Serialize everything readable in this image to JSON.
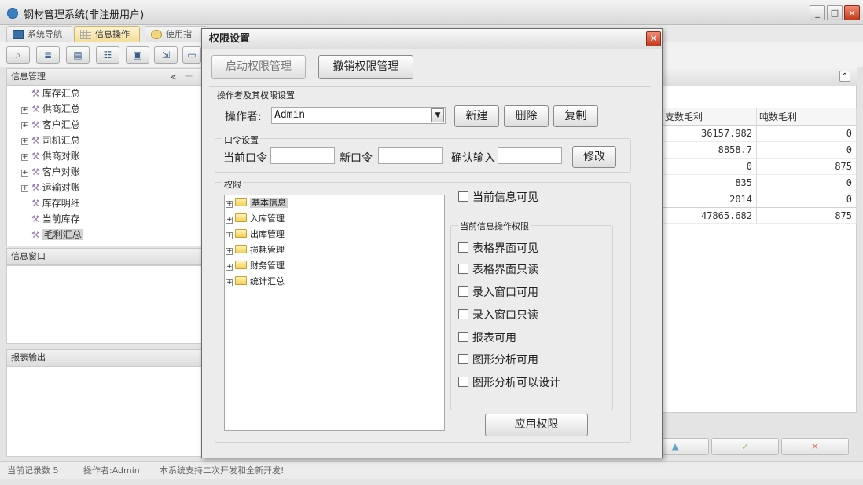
{
  "window": {
    "title": "钢材管理系统(非注册用户)",
    "min": "_",
    "max": "□",
    "close": "×"
  },
  "tabs": [
    {
      "label": "系统导航"
    },
    {
      "label": "信息操作"
    },
    {
      "label": "使用指南"
    }
  ],
  "sidebar": {
    "info_title": "信息管理",
    "collapse": "«",
    "items": [
      {
        "label": "库存汇总",
        "expand": ""
      },
      {
        "label": "供商汇总",
        "expand": "+"
      },
      {
        "label": "客户汇总",
        "expand": "+"
      },
      {
        "label": "司机汇总",
        "expand": "+"
      },
      {
        "label": "供商对账",
        "expand": "+"
      },
      {
        "label": "客户对账",
        "expand": "+"
      },
      {
        "label": "运输对账",
        "expand": "+"
      },
      {
        "label": "库存明细",
        "expand": ""
      },
      {
        "label": "当前库存",
        "expand": ""
      },
      {
        "label": "毛利汇总",
        "expand": "",
        "selected": true
      }
    ],
    "window_title": "信息窗口",
    "report_title": "报表输出"
  },
  "grid": {
    "columns": [
      "支数毛利",
      "吨数毛利"
    ],
    "rows": [
      [
        "36157.982",
        "0"
      ],
      [
        "8858.7",
        "0"
      ],
      [
        "0",
        "875"
      ],
      [
        "835",
        "0"
      ],
      [
        "2014",
        "0"
      ],
      [
        "47865.682",
        "875"
      ]
    ],
    "collapse": "⌃"
  },
  "nav_buttons": {
    "up": "▲",
    "ok": "✓",
    "cancel": "✕"
  },
  "status": {
    "records": "当前记录数 5",
    "operator": "操作者:Admin",
    "message": "本系统支持二次开发和全新开发!"
  },
  "dialog": {
    "title": "权限设置",
    "close": "✕",
    "start_btn": "启动权限管理",
    "revoke_btn": "撤销权限管理",
    "operator_group": "操作者及其权限设置",
    "operator_label": "操作者:",
    "operator_value": "Admin",
    "new_btn": "新建",
    "delete_btn": "删除",
    "copy_btn": "复制",
    "password_group": "口令设置",
    "current_pw": "当前口令",
    "new_pw": "新口令",
    "confirm_pw": "确认输入",
    "modify_btn": "修改",
    "perm_group": "权限",
    "perm_tree": [
      {
        "label": "基本信息",
        "selected": true
      },
      {
        "label": "入库管理"
      },
      {
        "label": "出库管理"
      },
      {
        "label": "损耗管理"
      },
      {
        "label": "财务管理"
      },
      {
        "label": "统计汇总"
      }
    ],
    "current_visible": "当前信息可见",
    "op_group": "当前信息操作权限",
    "ops": [
      "表格界面可见",
      "表格界面只读",
      "录入窗口可用",
      "录入窗口只读",
      "报表可用",
      "图形分析可用",
      "图形分析可以设计"
    ],
    "apply_btn": "应用权限"
  }
}
